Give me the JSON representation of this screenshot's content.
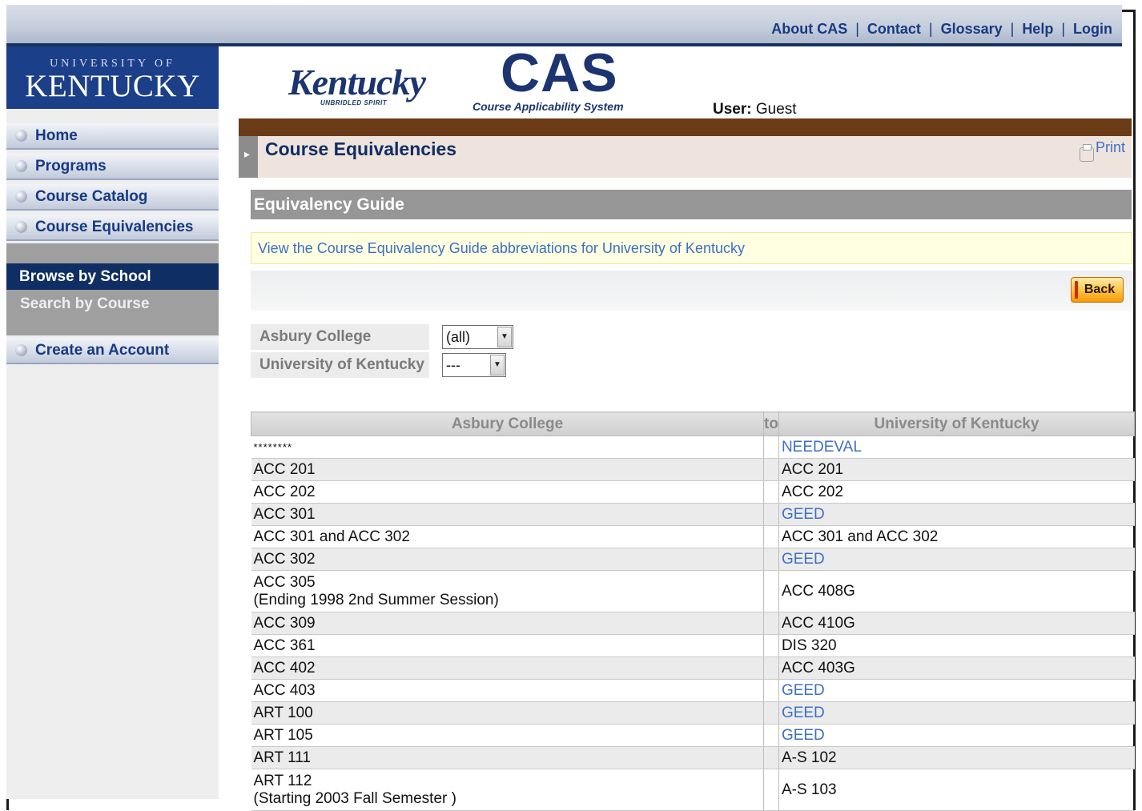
{
  "top_nav": {
    "links": [
      "About CAS",
      "Contact",
      "Glossary",
      "Help",
      "Login"
    ]
  },
  "logo": {
    "ux_small": "UNIVERSITY OF",
    "ux_big": "KENTUCKY",
    "ky_text": "Kentucky",
    "ky_tag": "UNBRIDLED SPIRIT",
    "cas_text": "CAS",
    "cas_tag": "Course Applicability System"
  },
  "user": {
    "label": "User:",
    "value": "Guest"
  },
  "sidebar": {
    "items": [
      "Home",
      "Programs",
      "Course Catalog",
      "Course Equivalencies"
    ],
    "sub_items": [
      "Browse by School",
      "Search by Course"
    ],
    "account_item": "Create an Account"
  },
  "page": {
    "title": "Course Equivalencies",
    "print_label": "Print",
    "section_title": "Equivalency Guide",
    "notice_link": "View the Course Equivalency Guide abbreviations for University of Kentucky",
    "back_label": "Back"
  },
  "filters": [
    {
      "label": "Asbury College",
      "value": "(all)"
    },
    {
      "label": "University of Kentucky",
      "value": "---"
    }
  ],
  "table": {
    "headers": {
      "from": "Asbury College",
      "to": "to",
      "uk": "University of Kentucky"
    },
    "rows": [
      {
        "from": "********",
        "from_note": "",
        "to": "NEEDEVAL",
        "to_link": true
      },
      {
        "from": "ACC 201",
        "from_note": "",
        "to": "ACC 201",
        "to_link": false
      },
      {
        "from": "ACC 202",
        "from_note": "",
        "to": "ACC 202",
        "to_link": false
      },
      {
        "from": "ACC 301",
        "from_note": "",
        "to": "GEED",
        "to_link": true
      },
      {
        "from": "ACC 301 and ACC 302",
        "from_note": "",
        "to": "ACC 301 and ACC 302",
        "to_link": false
      },
      {
        "from": "ACC 302",
        "from_note": "",
        "to": "GEED",
        "to_link": true
      },
      {
        "from": "ACC 305",
        "from_note": "(Ending 1998 2nd Summer Session)",
        "to": "ACC 408G",
        "to_link": false
      },
      {
        "from": "ACC 309",
        "from_note": "",
        "to": "ACC 410G",
        "to_link": false
      },
      {
        "from": "ACC 361",
        "from_note": "",
        "to": "DIS 320",
        "to_link": false
      },
      {
        "from": "ACC 402",
        "from_note": "",
        "to": "ACC 403G",
        "to_link": false
      },
      {
        "from": "ACC 403",
        "from_note": "",
        "to": "GEED",
        "to_link": true
      },
      {
        "from": "ART 100",
        "from_note": "",
        "to": "GEED",
        "to_link": true
      },
      {
        "from": "ART 105",
        "from_note": "",
        "to": "GEED",
        "to_link": true
      },
      {
        "from": "ART 111",
        "from_note": "",
        "to": "A-S 102",
        "to_link": false
      },
      {
        "from": "ART 112",
        "from_note": "(Starting 2003 Fall Semester )",
        "to": "A-S 103",
        "to_link": false
      }
    ]
  },
  "colors": {
    "navy": "#0f2e63",
    "link_blue": "#3d6fc5",
    "brown_bar": "#6b3a16",
    "uk_blue": "#1c3f8a"
  }
}
